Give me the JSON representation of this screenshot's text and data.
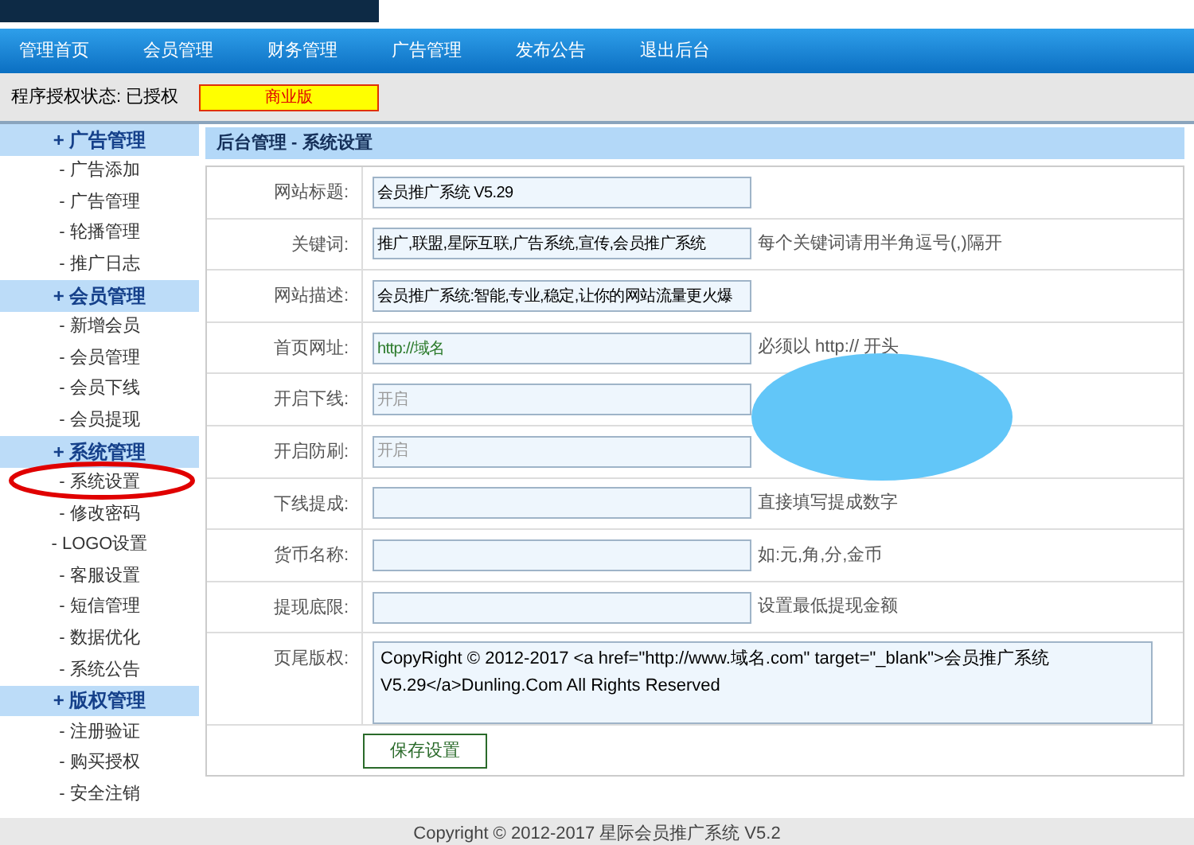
{
  "nav": [
    {
      "label": "管理首页"
    },
    {
      "label": "会员管理"
    },
    {
      "label": "财务管理"
    },
    {
      "label": "广告管理"
    },
    {
      "label": "发布公告"
    },
    {
      "label": "退出后台"
    }
  ],
  "status_bar": {
    "label": "程序授权状态: 已授权",
    "badge": "商业版"
  },
  "sidebar": [
    {
      "title": "+ 广告管理",
      "items": [
        "- 广告添加",
        "- 广告管理",
        "- 轮播管理",
        "- 推广日志"
      ]
    },
    {
      "title": "+ 会员管理",
      "items": [
        "- 新增会员",
        "- 会员管理",
        "- 会员下线",
        "- 会员提现"
      ]
    },
    {
      "title": "+ 系统管理",
      "items": [
        "- 系统设置",
        "- 修改密码",
        "- LOGO设置",
        "- 客服设置",
        "- 短信管理",
        "- 数据优化",
        "- 系统公告"
      ]
    },
    {
      "title": "+ 版权管理",
      "items": [
        "- 注册验证",
        "- 购买授权",
        "- 安全注销"
      ]
    }
  ],
  "panel_title": "后台管理 - 系统设置",
  "fields": [
    {
      "kind": "input",
      "label": "网站标题:",
      "value": "会员推广系统 V5.29"
    },
    {
      "kind": "input",
      "label": "关键词:",
      "value": "推广,联盟,星际互联,广告系统,宣传,会员推广系统",
      "hint": "每个关键词请用半角逗号(,)隔开"
    },
    {
      "kind": "input",
      "label": "网站描述:",
      "value": "会员推广系统:智能,专业,稳定,让你的网站流量更火爆"
    },
    {
      "kind": "input",
      "label": "首页网址:",
      "value": "http://域名",
      "green": true,
      "hint": "必须以 http:// 开头"
    },
    {
      "kind": "input",
      "label": "开启下线:",
      "placeholder": "开启"
    },
    {
      "kind": "input",
      "label": "开启防刷:",
      "placeholder": "开启"
    },
    {
      "kind": "input",
      "label": "下线提成:",
      "hint": "直接填写提成数字"
    },
    {
      "kind": "input",
      "label": "货币名称:",
      "hint": "如:元,角,分,金币"
    },
    {
      "kind": "input",
      "label": "提现底限:",
      "hint": "设置最低提现金额"
    },
    {
      "kind": "textarea",
      "label": "页尾版权:",
      "value": "CopyRight © 2012-2017 <a href=\"http://www.域名.com\" target=\"_blank\">会员推广系统 V5.29</a>Dunling.Com All Rights Reserved"
    }
  ],
  "save_button": "保存设置",
  "footer": "Copyright © 2012-2017 星际会员推广系统 V5.2"
}
